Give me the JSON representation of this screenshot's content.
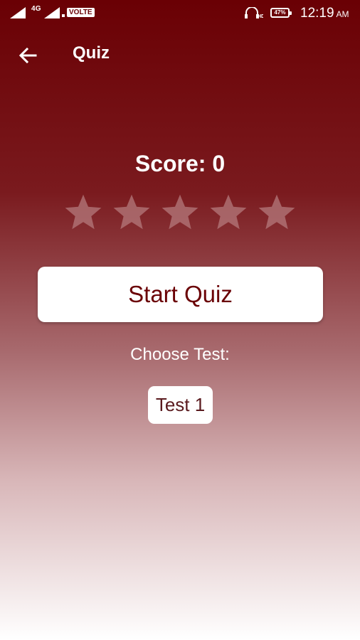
{
  "status_bar": {
    "network_1": "4G",
    "network_2": "VOLTE",
    "hd_icon": "hd-headset-icon",
    "battery": "47%",
    "time": "12:19",
    "ampm": "AM"
  },
  "app_bar": {
    "back_icon": "arrow-back-icon",
    "title": "Quiz"
  },
  "score": {
    "text": "Score: 0",
    "stars_total": 5,
    "stars_filled": 0
  },
  "start_button": {
    "label": "Start Quiz"
  },
  "choose": {
    "label": "Choose Test:",
    "options": [
      "Test 1"
    ]
  },
  "colors": {
    "primary": "#6a0004",
    "star_empty": "#b47a7c"
  }
}
